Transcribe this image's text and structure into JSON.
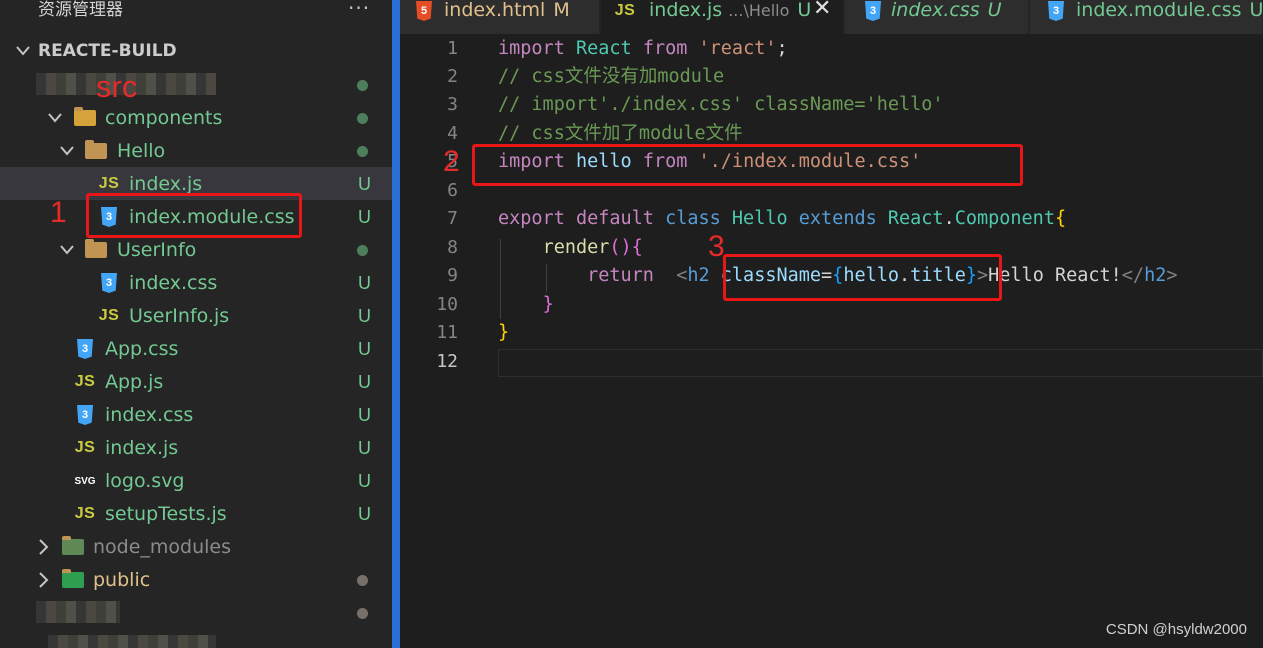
{
  "sidebar": {
    "title": "资源管理器",
    "more": "···",
    "root": "REACTE-BUILD",
    "src_annotation": "src",
    "items": [
      {
        "label": "components",
        "status": ""
      },
      {
        "label": "Hello",
        "status": ""
      },
      {
        "label": "index.js",
        "status": "U"
      },
      {
        "label": "index.module.css",
        "status": "U"
      },
      {
        "label": "UserInfo",
        "status": ""
      },
      {
        "label": "index.css",
        "status": "U"
      },
      {
        "label": "UserInfo.js",
        "status": "U"
      },
      {
        "label": "App.css",
        "status": "U"
      },
      {
        "label": "App.js",
        "status": "U"
      },
      {
        "label": "index.css",
        "status": "U"
      },
      {
        "label": "index.js",
        "status": "U"
      },
      {
        "label": "logo.svg",
        "status": "U"
      },
      {
        "label": "setupTests.js",
        "status": "U"
      },
      {
        "label": "node_modules",
        "status": ""
      },
      {
        "label": "public",
        "status": ""
      }
    ]
  },
  "icons": {
    "js": "JS",
    "css": "3",
    "html": "5",
    "svg": "SVG"
  },
  "tabs": [
    {
      "label": "index.html",
      "hint": "",
      "status": "M"
    },
    {
      "label": "index.js",
      "hint": "...\\Hello",
      "status": "U",
      "close": "✕"
    },
    {
      "label": "index.css",
      "hint": "",
      "status": "U"
    },
    {
      "label": "index.module.css",
      "hint": "",
      "status": "U"
    }
  ],
  "editor": {
    "line_numbers": [
      "1",
      "2",
      "3",
      "4",
      "5",
      "6",
      "7",
      "8",
      "9",
      "10",
      "11",
      "12"
    ],
    "line1": {
      "kw": "import",
      "id": "React",
      "kw2": "from",
      "str": "'react'",
      "end": ";"
    },
    "line2": "// css文件没有加module",
    "line3": "// import'./index.css' className='hello'",
    "line4": "// css文件加了module文件",
    "line5": {
      "kw": "import",
      "id": "hello",
      "kw2": "from",
      "str": "'./index.module.css'"
    },
    "line7": {
      "k1": "export",
      "k2": "default",
      "k3": "class",
      "c1": "Hello",
      "k4": "extends",
      "c2": "React",
      "dot": ".",
      "c3": "Component",
      "b": "{"
    },
    "line8": {
      "fn": "render",
      "p": "()",
      "b": "{"
    },
    "line9": {
      "kw": "return",
      "lt": "<",
      "tag": "h2",
      "attr": "className",
      "eq": "=",
      "b1": "{",
      "obj": "hello",
      "dot": ".",
      "prop": "title",
      "b2": "}",
      "gt": ">",
      "text": "Hello React!",
      "close_lt": "</",
      "close_tag": "h2",
      "close_gt": ">"
    },
    "line10": "}",
    "line11": "}"
  },
  "annotations": {
    "n1": "1",
    "n2": "2",
    "n3": "3"
  },
  "watermark": "CSDN @hsyldw2000"
}
